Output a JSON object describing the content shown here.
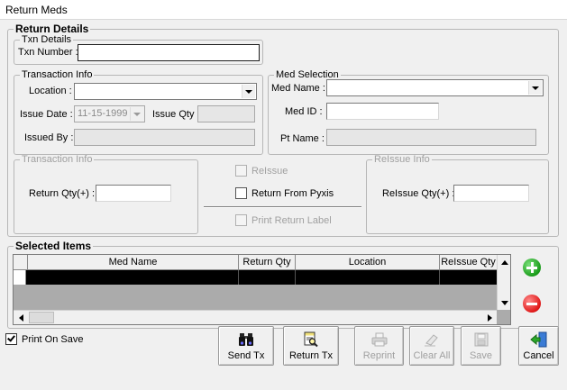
{
  "window": {
    "title": "Return Meds"
  },
  "return_details": {
    "legend": "Return Details",
    "txn_details": {
      "legend": "Txn Details",
      "txn_number_label": "Txn Number :",
      "txn_number_value": ""
    },
    "transaction_info": {
      "legend": "Transaction Info",
      "location_label": "Location :",
      "location_value": "",
      "issue_date_label": "Issue Date :",
      "issue_date_value": "11-15-1999",
      "issue_qty_label": "Issue Qty :",
      "issue_qty_value": "",
      "issued_by_label": "Issued By :",
      "issued_by_value": ""
    },
    "med_selection": {
      "legend": "Med Selection",
      "med_name_label": "Med Name :",
      "med_name_value": "",
      "med_id_label": "Med ID :",
      "med_id_value": "",
      "pt_name_label": "Pt Name :",
      "pt_name_value": ""
    },
    "return_transaction_info": {
      "legend": "Transaction Info",
      "return_qty_label": "Return Qty(+) :",
      "return_qty_value": ""
    },
    "options": {
      "reissue_label": "ReIssue",
      "reissue_checked": false,
      "return_from_pyxis_label": "Return From Pyxis",
      "return_from_pyxis_checked": false,
      "print_return_label_label": "Print Return  Label",
      "print_return_label_checked": false
    },
    "reissue_info": {
      "legend": "ReIssue Info",
      "reissue_qty_label": "ReIssue Qty(+) :",
      "reissue_qty_value": ""
    }
  },
  "selected_items": {
    "legend": "Selected Items",
    "columns": [
      "Med Name",
      "Return Qty",
      "Location",
      "ReIssue Qty"
    ]
  },
  "print_on_save": {
    "label": "Print On Save",
    "checked": true
  },
  "toolbar": {
    "send_tx": "Send Tx",
    "return_tx": "Return Tx",
    "reprint": "Reprint",
    "clear_all": "Clear All",
    "save": "Save",
    "cancel": "Cancel"
  },
  "icons": {
    "add": "add-circle-icon",
    "remove": "remove-circle-icon",
    "send": "binoculars-icon",
    "return": "document-search-icon",
    "reprint": "printer-icon",
    "clear": "eraser-icon",
    "save": "floppy-disk-icon",
    "cancel": "exit-door-icon"
  }
}
